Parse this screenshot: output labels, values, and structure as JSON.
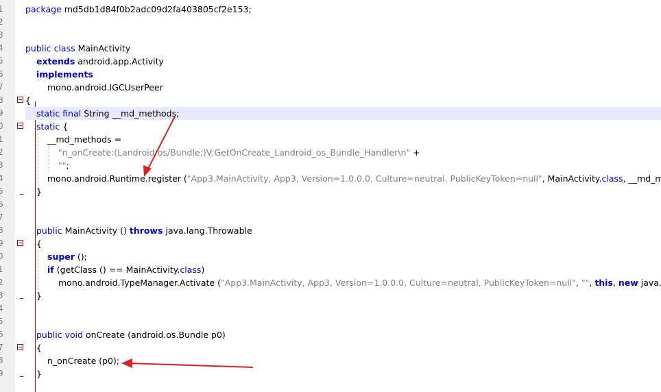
{
  "line_numbers": [
    "1",
    "2",
    "3",
    "4",
    "5",
    "6",
    "7",
    "8",
    "9",
    "0",
    "1",
    "2",
    "3",
    "4",
    "5",
    "6",
    "7",
    "8",
    "9",
    "0",
    "1",
    "2",
    "3",
    "4",
    "5",
    "6",
    "7",
    "8",
    "9"
  ],
  "code": {
    "l1_kw": "package",
    "l1_rest": " md5db1d84f0b2adc09d2fa403805cf2e153;",
    "l4_kw": "public class",
    "l4_rest": " MainActivity",
    "l5_kw": "extends",
    "l5_rest": " android.app.Activity",
    "l6_kw": "implements",
    "l7_text": "mono.android.IGCUserPeer",
    "l8_text": "{",
    "l9_kw": "static final",
    "l9_rest": " String __md_methods;",
    "l10_kw": "static",
    "l10_rest": " {",
    "l11_text": "__md_methods =",
    "l12_str": "\"n_onCreate:(Landroid/os/Bundle;)V:GetOnCreate_Landroid_os_Bundle_Handler\\n\"",
    "l12_rest": " +",
    "l13_str": "\"\"",
    "l13_rest": ";",
    "l14_a": "mono.android.Runtime.register (",
    "l14_str": "\"App3.MainActivity, App3, Version=1.0.0.0, Culture=neutral, PublicKeyToken=null\"",
    "l14_b": ", MainActivity.",
    "l14_kw": "class",
    "l14_c": ", __md_met",
    "l15_text": "}",
    "l18_kw": "public",
    "l18_rest": " MainActivity () ",
    "l18_kw2": "throws",
    "l18_rest2": " java.lang.Throwable",
    "l19_text": "{",
    "l20_kw": "super",
    "l20_rest": " ();",
    "l21_kw": "if",
    "l21_rest": " (getClass () == MainActivity.",
    "l21_kw2": "class",
    "l21_rest2": ")",
    "l22_a": "mono.android.TypeManager.Activate (",
    "l22_str": "\"App3.MainActivity, App3, Version=1.0.0.0, Culture=neutral, PublicKeyToken=null\"",
    "l22_b": ", ",
    "l22_str2": "\"\"",
    "l22_c": ", ",
    "l22_kw": "this",
    "l22_d": ", ",
    "l22_kw2": "new",
    "l22_e": " java.lan",
    "l23_text": "}",
    "l26_kw": "public void",
    "l26_rest": " onCreate (android.os.Bundle p0)",
    "l27_text": "{",
    "l28_text": "n_onCreate (p0);",
    "l29_text": "}"
  },
  "annotation_color": "#e02020"
}
